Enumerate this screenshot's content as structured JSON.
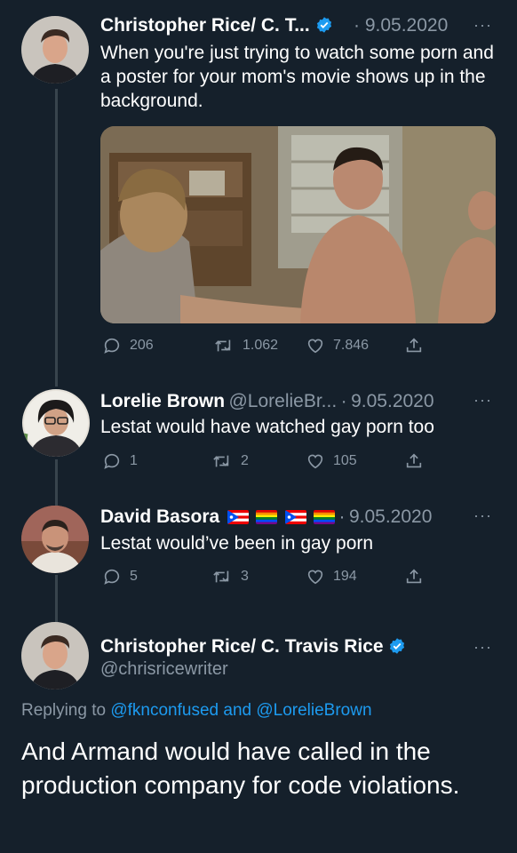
{
  "tweets": [
    {
      "author": "Christopher Rice/ C. T...",
      "date": "9.05.2020",
      "text": "When you're just trying to watch some porn and a poster for your mom's movie shows up in the background.",
      "replies": "206",
      "retweets": "1.062",
      "likes": "7.846"
    },
    {
      "author": "Lorelie Brown",
      "handle": "@LorelieBr...",
      "date": "9.05.2020",
      "text": "Lestat would have watched gay porn too",
      "replies": "1",
      "retweets": "2",
      "likes": "105"
    },
    {
      "author": "David Basora",
      "date": "9.05.2020",
      "text": "Lestat would’ve been in gay porn",
      "replies": "5",
      "retweets": "3",
      "likes": "194"
    }
  ],
  "main_tweet": {
    "author": "Christopher Rice/ C. Travis Rice",
    "handle": "@chrisricewriter",
    "replying_prefix": "Replying to",
    "reply_handle_1": "@fknconfused",
    "reply_and": "and",
    "reply_handle_2": "@LorelieBrown",
    "text": "And Armand would have called in the production company for code violations."
  },
  "separator": "·",
  "more_glyph": "···",
  "icons": [
    "reply-icon",
    "retweet-icon",
    "like-icon",
    "share-icon",
    "verified-icon",
    "more-icon"
  ],
  "colors": {
    "background": "#15202b",
    "muted": "#8b98a5",
    "accent": "#1d9bf0",
    "thread_line": "#38444d"
  }
}
